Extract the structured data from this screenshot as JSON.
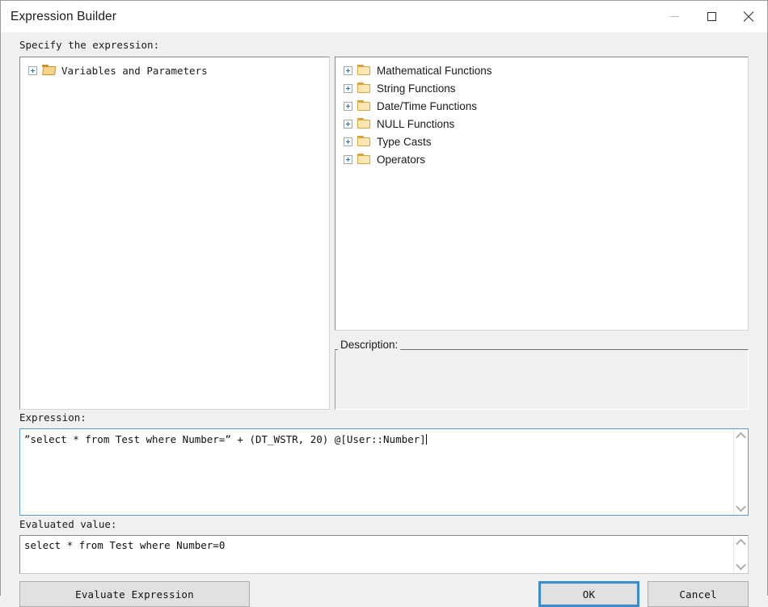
{
  "window": {
    "title": "Expression Builder",
    "controls": {
      "minimize": "minimize",
      "maximize": "maximize",
      "close": "close"
    }
  },
  "labels": {
    "specify": "Specify the expression:",
    "description": "Description:",
    "expression": "Expression:",
    "evaluated_value": "Evaluated value:"
  },
  "left_tree": {
    "items": [
      {
        "label": "Variables and Parameters",
        "icon": "folder-open-icon",
        "expander": "plus",
        "expanded": false
      }
    ]
  },
  "right_tree": {
    "items": [
      {
        "label": "Mathematical Functions",
        "icon": "folder-icon",
        "expander": "plus",
        "expanded": false
      },
      {
        "label": "String Functions",
        "icon": "folder-icon",
        "expander": "plus",
        "expanded": false
      },
      {
        "label": "Date/Time Functions",
        "icon": "folder-icon",
        "expander": "plus",
        "expanded": false
      },
      {
        "label": "NULL Functions",
        "icon": "folder-icon",
        "expander": "plus",
        "expanded": false
      },
      {
        "label": "Type Casts",
        "icon": "folder-icon",
        "expander": "plus",
        "expanded": false
      },
      {
        "label": "Operators",
        "icon": "folder-icon",
        "expander": "plus",
        "expanded": false
      }
    ]
  },
  "description": {
    "text": ""
  },
  "expression": {
    "value": "”select * from Test where Number=” + (DT_WSTR, 20) @[User::Number]"
  },
  "evaluated": {
    "value": "select * from Test where Number=0"
  },
  "buttons": {
    "evaluate": "Evaluate Expression",
    "ok": "OK",
    "cancel": "Cancel"
  },
  "colors": {
    "accent_focus": "#3c8ccc",
    "editor_border": "#5a9fd4",
    "dialog_background": "#f0f0f0",
    "titlebar_background": "#ffffff",
    "folder_yellow": "#fbe6b4"
  }
}
